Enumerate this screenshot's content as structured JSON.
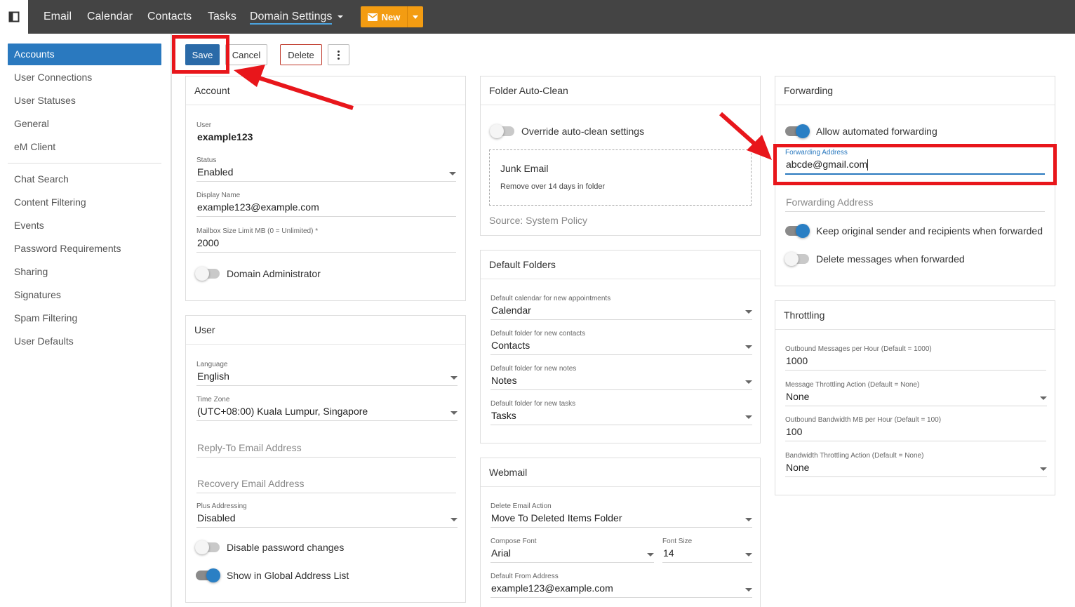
{
  "topbar": {
    "nav": [
      {
        "label": "Email"
      },
      {
        "label": "Calendar"
      },
      {
        "label": "Contacts"
      },
      {
        "label": "Tasks"
      },
      {
        "label": "Domain Settings"
      }
    ],
    "new_label": "New"
  },
  "sidebar": {
    "items": [
      {
        "label": "Accounts"
      },
      {
        "label": "User Connections"
      },
      {
        "label": "User Statuses"
      },
      {
        "label": "General"
      },
      {
        "label": "eM Client"
      },
      {
        "label": "Chat Search"
      },
      {
        "label": "Content Filtering"
      },
      {
        "label": "Events"
      },
      {
        "label": "Password Requirements"
      },
      {
        "label": "Sharing"
      },
      {
        "label": "Signatures"
      },
      {
        "label": "Spam Filtering"
      },
      {
        "label": "User Defaults"
      }
    ]
  },
  "toolbar": {
    "save": "Save",
    "cancel": "Cancel",
    "delete": "Delete"
  },
  "account": {
    "title": "Account",
    "user_label": "User",
    "user_value": "example123",
    "status_label": "Status",
    "status_value": "Enabled",
    "display_label": "Display Name",
    "display_value": "example123@example.com",
    "mailbox_label": "Mailbox Size Limit MB (0 = Unlimited) *",
    "mailbox_value": "2000",
    "domain_admin": "Domain Administrator"
  },
  "user": {
    "title": "User",
    "language_label": "Language",
    "language_value": "English",
    "timezone_label": "Time Zone",
    "timezone_value": "(UTC+08:00) Kuala Lumpur, Singapore",
    "replyto_placeholder": "Reply-To Email Address",
    "recovery_placeholder": "Recovery Email Address",
    "plus_label": "Plus Addressing",
    "plus_value": "Disabled",
    "disable_pw": "Disable password changes",
    "show_gal": "Show in Global Address List"
  },
  "autoclean": {
    "title": "Folder Auto-Clean",
    "override": "Override auto-clean settings",
    "junk_title": "Junk Email",
    "junk_desc": "Remove over 14 days in folder",
    "source": "Source: System Policy"
  },
  "folders": {
    "title": "Default Folders",
    "cal_label": "Default calendar for new appointments",
    "cal_value": "Calendar",
    "contacts_label": "Default folder for new contacts",
    "contacts_value": "Contacts",
    "notes_label": "Default folder for new notes",
    "notes_value": "Notes",
    "tasks_label": "Default folder for new tasks",
    "tasks_value": "Tasks"
  },
  "webmail": {
    "title": "Webmail",
    "delete_label": "Delete Email Action",
    "delete_value": "Move To Deleted Items Folder",
    "font_label": "Compose Font",
    "font_value": "Arial",
    "size_label": "Font Size",
    "size_value": "14",
    "from_label": "Default From Address",
    "from_value": "example123@example.com"
  },
  "forwarding": {
    "title": "Forwarding",
    "allow": "Allow automated forwarding",
    "addr_label": "Forwarding Address",
    "addr_value": "abcde@gmail.com",
    "addr2_placeholder": "Forwarding Address",
    "keep": "Keep original sender and recipients when forwarded",
    "delete": "Delete messages when forwarded"
  },
  "throttling": {
    "title": "Throttling",
    "msg_label": "Outbound Messages per Hour (Default = 1000)",
    "msg_value": "1000",
    "msg_action_label": "Message Throttling Action (Default = None)",
    "msg_action_value": "None",
    "bw_label": "Outbound Bandwidth MB per Hour (Default = 100)",
    "bw_value": "100",
    "bw_action_label": "Bandwidth Throttling Action (Default = None)",
    "bw_action_value": "None"
  },
  "colors": {
    "topbar": "#444444",
    "accent": "#2a79bf",
    "new_button": "#f39c12",
    "annotation": "#e8161b"
  }
}
